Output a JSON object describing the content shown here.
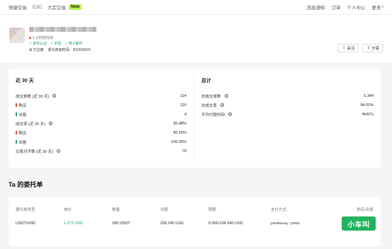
{
  "nav": {
    "left": [
      "快捷交易",
      "C2C",
      "大宗交易"
    ],
    "new_badge": "New",
    "right": [
      "消息通知",
      "订单",
      "个人中心",
      "更多"
    ]
  },
  "profile": {
    "online": "1 小时前在线",
    "verify": [
      "身份认证",
      "手机",
      "电子邮件"
    ],
    "registered_label": "已注册",
    "merchant_since": "成为商家时间：2024/09/23",
    "follow_label": "关注",
    "share_label": "分享"
  },
  "stats": {
    "recent": {
      "title": "近 30 天",
      "rows": [
        {
          "label": "成交单数 (近 30 天)",
          "value": "114",
          "type": "main",
          "info": true
        },
        {
          "label": "购买",
          "value": "110",
          "type": "buy"
        },
        {
          "label": "出售",
          "value": "4",
          "type": "sell"
        },
        {
          "label": "成交率 (近 30 天)",
          "value": "90.48%",
          "type": "main",
          "info": true
        },
        {
          "label": "购买",
          "value": "90.16%",
          "type": "buy"
        },
        {
          "label": "出售",
          "value": "100.00%",
          "type": "sell"
        },
        {
          "label": "交易对手数 (近 30 天)",
          "value": "79",
          "type": "main",
          "info": true
        }
      ]
    },
    "total": {
      "title": "总计",
      "rows": [
        {
          "label": "总成交单数",
          "value": "5,344",
          "info": true
        },
        {
          "label": "总成交率",
          "value": "94.01%",
          "info": true
        },
        {
          "label": "平均付款时间",
          "value": "4m57s",
          "info": true
        }
      ]
    }
  },
  "orders": {
    "title": "Ta 的委托单",
    "headers": [
      "委托单类型",
      "单价",
      "数量",
      "总额",
      "限额",
      "支付方式",
      "购买/出售"
    ],
    "row": {
      "type": "USDT/USD",
      "price": "1.277 USD",
      "quantity": "185 USDT",
      "total": "236.245 USD",
      "limit": "5.000-236.240 USD",
      "payments": [
        "WebMoney",
        "WMZ"
      ],
      "action": "购买"
    }
  },
  "watermark": "小车叫",
  "colors": {
    "accent_green": "#1e9e5a",
    "new_badge": "#b7f24a",
    "buy_red": "#e74c3c"
  }
}
